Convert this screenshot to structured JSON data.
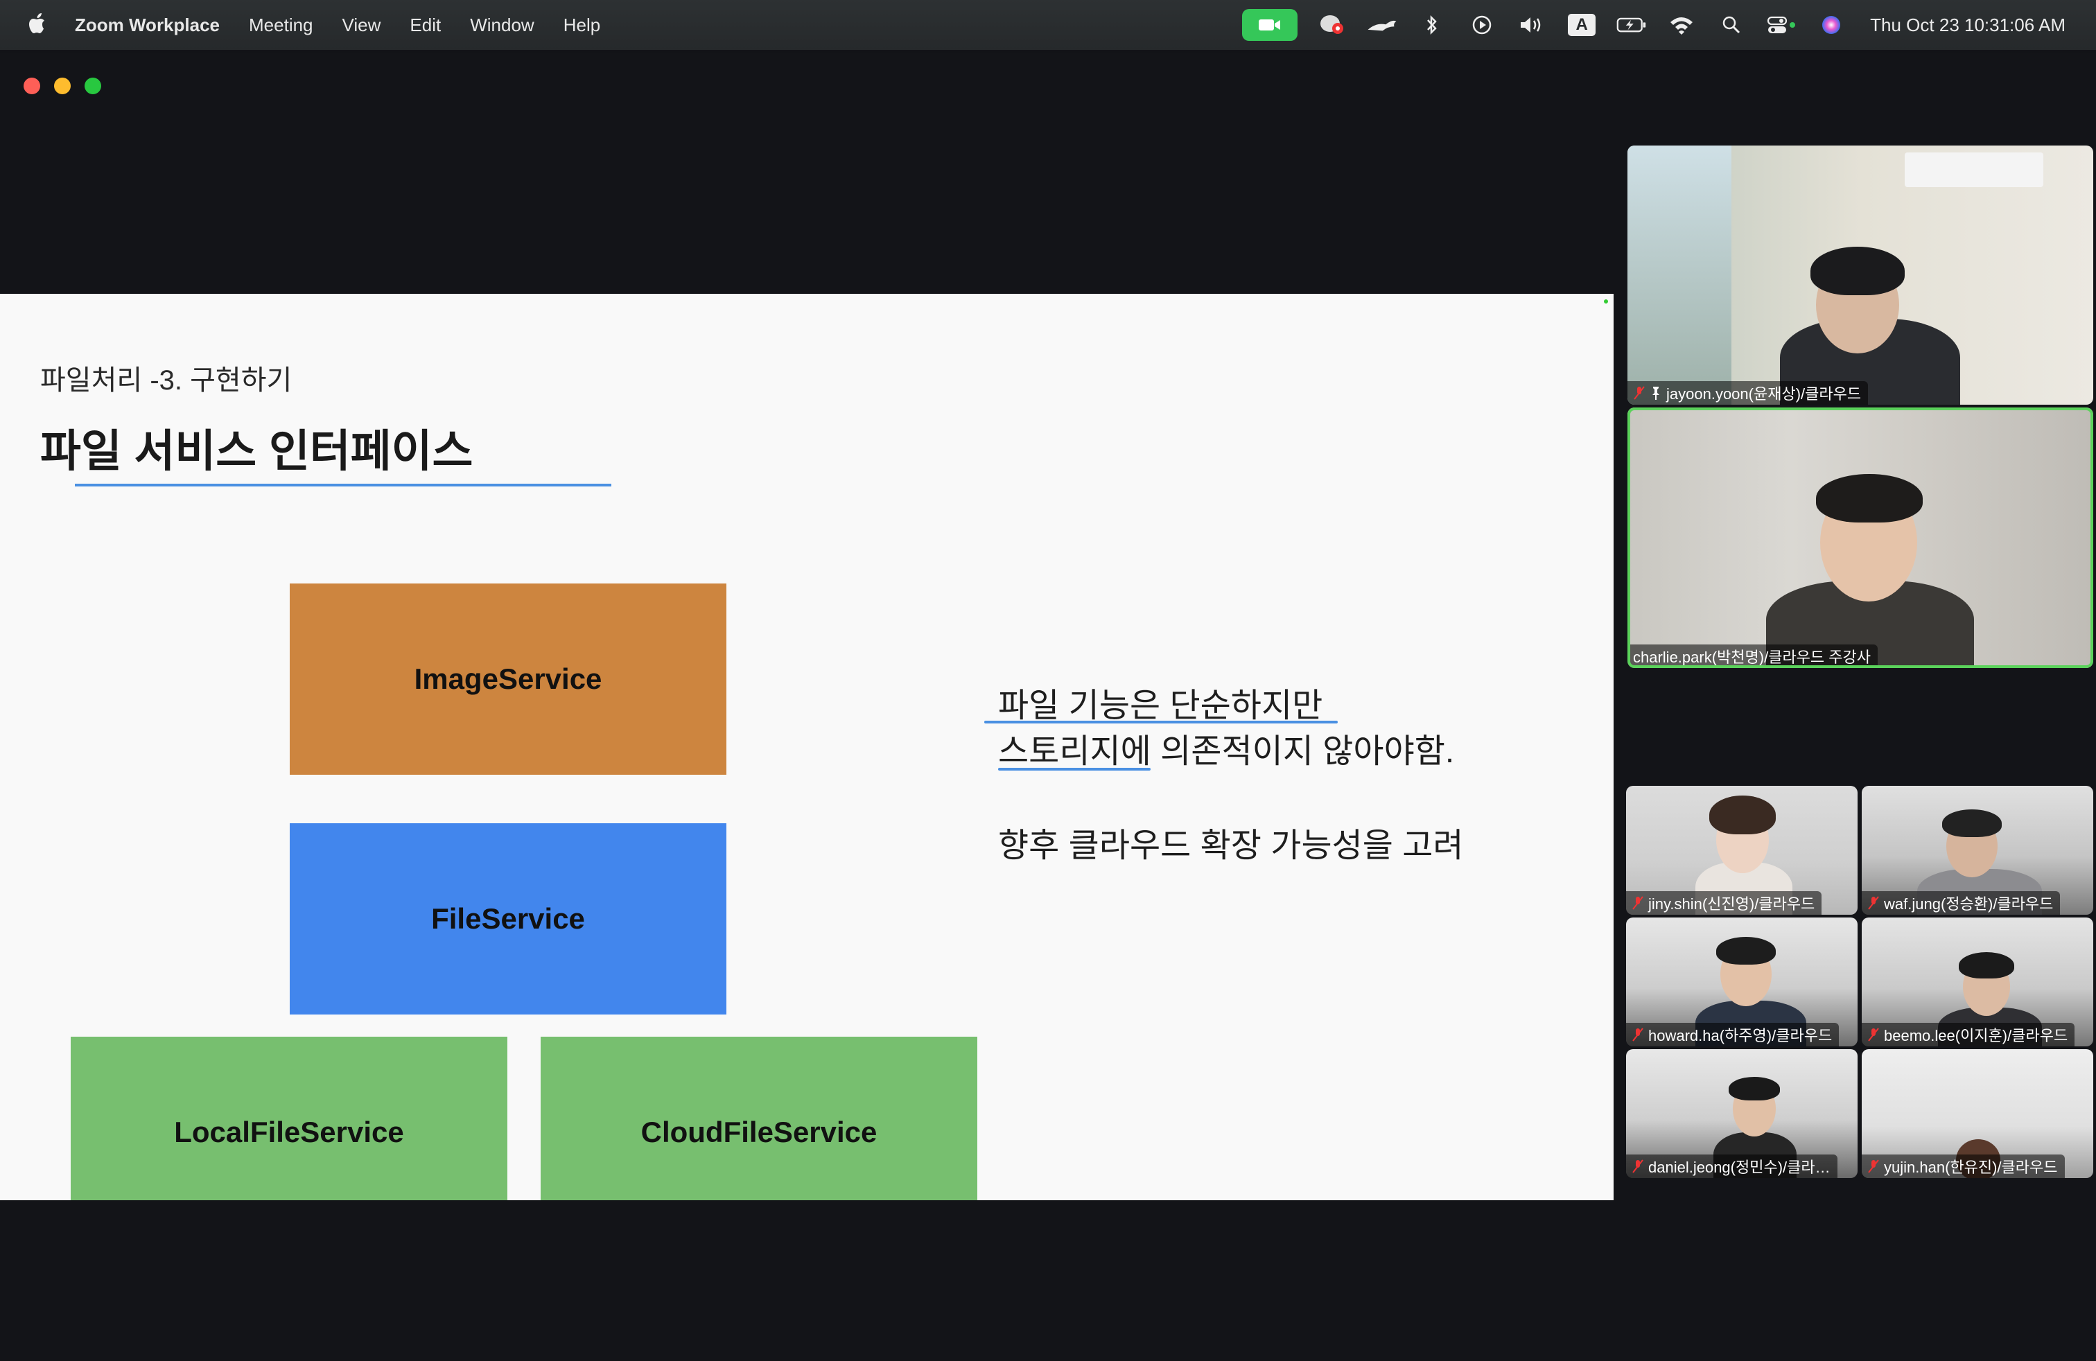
{
  "menubar": {
    "app_name": "Zoom Workplace",
    "items": [
      "Meeting",
      "View",
      "Edit",
      "Window",
      "Help"
    ],
    "clock": "Thu Oct 23  10:31:06 AM",
    "input_source": "A"
  },
  "slide": {
    "subtitle": "파일처리 -3. 구현하기",
    "title": "파일 서비스 인터페이스",
    "boxes": {
      "image": "ImageService",
      "file": "FileService",
      "local": "LocalFileService",
      "cloud": "CloudFileService"
    },
    "notes": [
      "파일 기능은 단순하지만",
      "스토리지에 의존적이지 않아야함.",
      "향후 클라우드 확장 가능성을 고려"
    ],
    "colors": {
      "image_box": "#cd853f",
      "file_box": "#4286ed",
      "impl_box": "#77bf6f",
      "underline": "#4a90e2"
    }
  },
  "participants": {
    "pinned": {
      "name": "jayoon.yoon(윤재상)/클라우드",
      "muted": true,
      "pinned": true
    },
    "speaker": {
      "name": "charlie.park(박천명)/클라우드 주강사",
      "active": true
    },
    "gallery": [
      {
        "name": "jiny.shin(신진영)/클라우드",
        "muted": true
      },
      {
        "name": "waf.jung(정승환)/클라우드",
        "muted": true
      },
      {
        "name": "howard.ha(하주영)/클라우드",
        "muted": true
      },
      {
        "name": "beemo.lee(이지훈)/클라우드",
        "muted": true
      },
      {
        "name": "daniel.jeong(정민수)/클라…",
        "muted": true
      },
      {
        "name": "yujin.han(한유진)/클라우드",
        "muted": true
      }
    ]
  }
}
